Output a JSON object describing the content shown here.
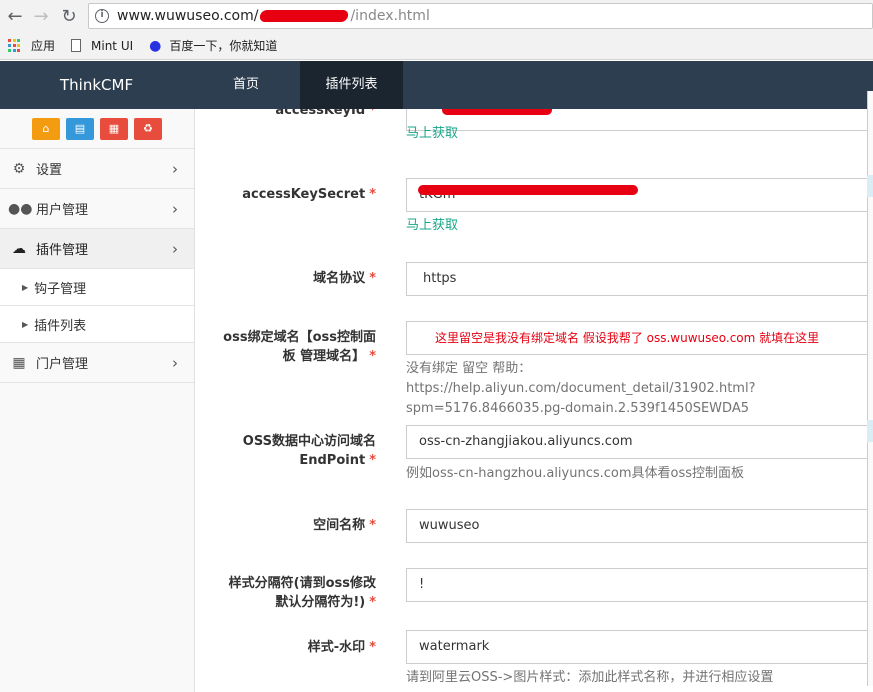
{
  "browser": {
    "url_host": "www.wuwuseo.com/",
    "url_path": "/index.html",
    "bookmarks": [
      {
        "label": "应用",
        "icon": "apps-grid-icon"
      },
      {
        "label": "Mint UI",
        "icon": "page-icon"
      },
      {
        "label": "百度一下，你就知道",
        "icon": "baidu-paw-icon"
      }
    ]
  },
  "app": {
    "brand": "ThinkCMF",
    "topnav": [
      {
        "label": "首页"
      },
      {
        "label": "插件列表"
      }
    ]
  },
  "sidebar": {
    "quick_buttons": [
      {
        "icon": "home-icon",
        "color": "#f39c12"
      },
      {
        "icon": "file-icon",
        "color": "#3498db"
      },
      {
        "icon": "trash-icon",
        "color": "#e74c3c"
      },
      {
        "icon": "recycle-icon",
        "color": "#e74c3c"
      }
    ],
    "items": [
      {
        "label": "设置",
        "icon": "gears-icon"
      },
      {
        "label": "用户管理",
        "icon": "users-icon"
      },
      {
        "label": "插件管理",
        "icon": "cloud-icon"
      },
      {
        "label": "钩子管理"
      },
      {
        "label": "插件列表"
      },
      {
        "label": "门户管理",
        "icon": "grid-icon"
      }
    ]
  },
  "form": {
    "required_mark": "*",
    "access_key_id": {
      "label": "accessKeyId",
      "help": "马上获取"
    },
    "access_key_secret": {
      "label": "accessKeySecret",
      "value": "tKGm",
      "help": "马上获取"
    },
    "protocol": {
      "label": "域名协议",
      "value": "https"
    },
    "oss_domain": {
      "label_line1": "oss绑定域名【oss控制面",
      "label_line2": "板 管理域名】",
      "value": "这里留空是我没有绑定域名  假设我帮了 oss.wuwuseo.com 就填在这里",
      "help_line1": "没有绑定 留空 帮助：https://help.aliyun.com/document_detail/31902.html?",
      "help_line2": "spm=5176.8466035.pg-domain.2.539f1450SEWDA5"
    },
    "endpoint": {
      "label_line1": "OSS数据中心访问域名",
      "label_line2": "EndPoint",
      "value": "oss-cn-zhangjiakou.aliyuncs.com",
      "help": "例如oss-cn-hangzhou.aliyuncs.com具体看oss控制面板"
    },
    "bucket": {
      "label": "空间名称",
      "value": "wuwuseo"
    },
    "separator": {
      "label_line1": "样式分隔符(请到oss修改",
      "label_line2": "默认分隔符为!)",
      "value": "!"
    },
    "watermark": {
      "label": "样式-水印",
      "value": "watermark",
      "help": "请到阿里云OSS->图片样式：添加此样式名称，并进行相应设置"
    }
  }
}
